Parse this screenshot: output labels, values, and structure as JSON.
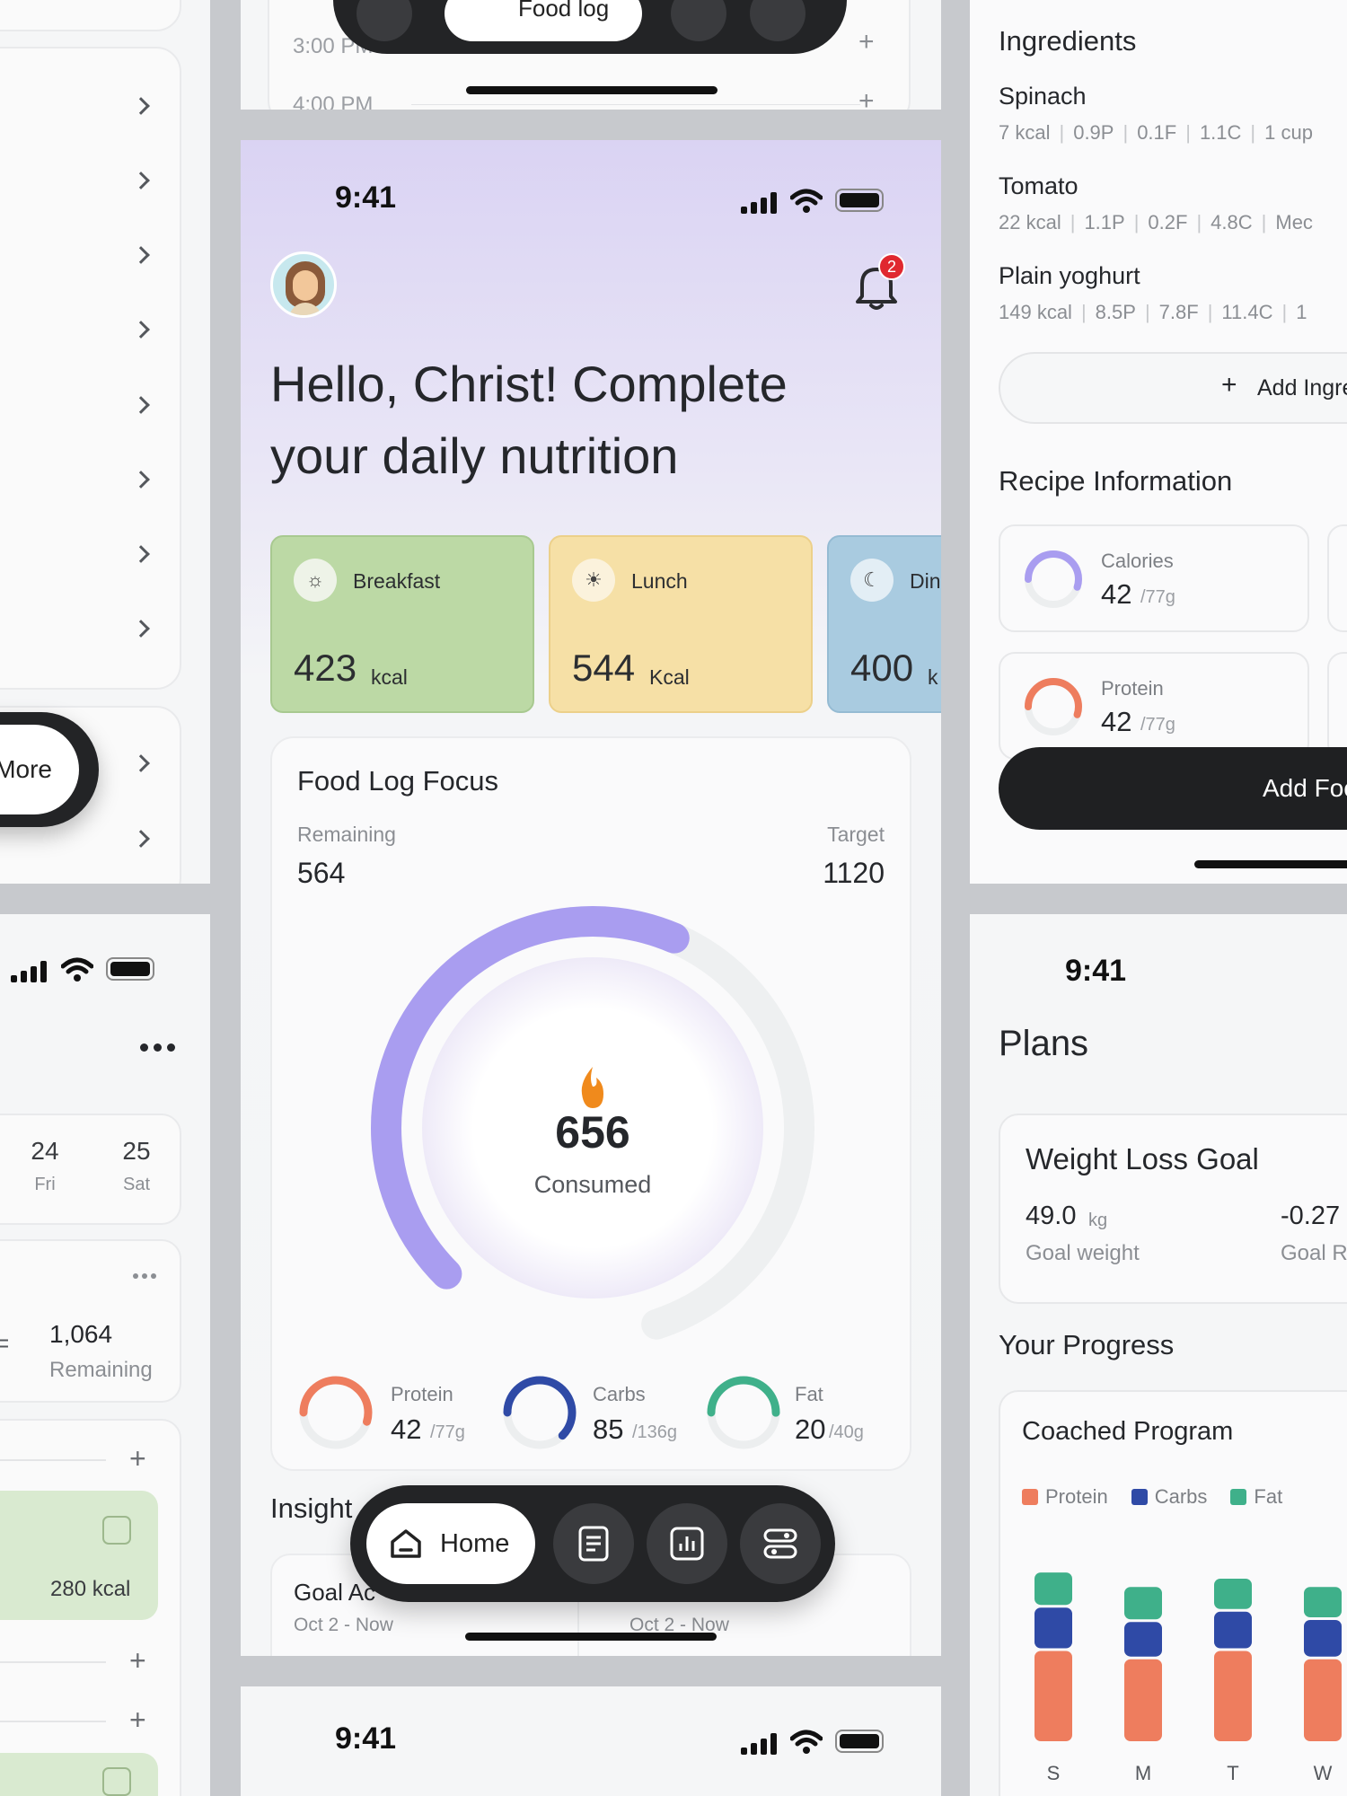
{
  "left_top": {
    "more_label": "More"
  },
  "top_mid": {
    "times": [
      "3:00 PM",
      "4:00 PM"
    ],
    "nav_active_label": "Food log"
  },
  "main": {
    "status_time": "9:41",
    "notification_count": "2",
    "greeting_line1": "Hello, Christ! Complete",
    "greeting_line2": "your daily nutrition",
    "meals": [
      {
        "label": "Breakfast",
        "value": "423",
        "unit": "kcal",
        "color": "#bcd9a5"
      },
      {
        "label": "Lunch",
        "value": "544",
        "unit": "Kcal",
        "color": "#f6e0a6"
      },
      {
        "label": "Din",
        "value": "400",
        "unit": "k",
        "color": "#a9cbe0"
      }
    ],
    "focus": {
      "title": "Food Log Focus",
      "remaining_label": "Remaining",
      "remaining_value": "564",
      "target_label": "Target",
      "target_value": "1120",
      "consumed_value": "656",
      "consumed_label": "Consumed",
      "progress_fraction": 0.586,
      "macros": [
        {
          "name": "Protein",
          "value": "42",
          "total": "/77g",
          "fraction": 0.545,
          "color": "#ee7d5e"
        },
        {
          "name": "Carbs",
          "value": "85",
          "total": "/136g",
          "fraction": 0.625,
          "color": "#2f4aa6"
        },
        {
          "name": "Fat",
          "value": "20",
          "total": "/40g",
          "fraction": 0.5,
          "color": "#3fb08a"
        }
      ]
    },
    "insights_title": "Insight",
    "insight_cards": [
      {
        "title": "Goal Ac",
        "date": "Oct 2 - Now"
      },
      {
        "title": "",
        "date": "Oct 2 - Now"
      }
    ],
    "nav_home_label": "Home"
  },
  "bottom_mid": {
    "status_time": "9:41"
  },
  "left_bottom": {
    "days": [
      {
        "num": "24",
        "name": "Fri"
      },
      {
        "num": "25",
        "name": "Sat"
      }
    ],
    "remaining_value": "1,064",
    "remaining_label": "Remaining",
    "equals": "=",
    "meal_kcal": "280 kcal"
  },
  "right_top": {
    "ingredients_title": "Ingredients",
    "ingredients": [
      {
        "name": "Spinach",
        "stats": [
          "7 kcal",
          "0.9P",
          "0.1F",
          "1.1C",
          "1 cup"
        ]
      },
      {
        "name": "Tomato",
        "stats": [
          "22 kcal",
          "1.1P",
          "0.2F",
          "4.8C",
          "Mec"
        ]
      },
      {
        "name": "Plain yoghurt",
        "stats": [
          "149 kcal",
          "8.5P",
          "7.8F",
          "11.4C",
          "1"
        ]
      }
    ],
    "add_ingredient_label": "Add Ingre",
    "recipe_title": "Recipe Information",
    "recipe_items": [
      {
        "name": "Calories",
        "value": "42",
        "total": "/77g",
        "fraction": 0.55,
        "color": "#a99df0"
      },
      {
        "name": "Protein",
        "value": "42",
        "total": "/77g",
        "fraction": 0.55,
        "color": "#ee7d5e"
      }
    ],
    "add_food_label": "Add Foo"
  },
  "right_bottom": {
    "status_time": "9:41",
    "title": "Plans",
    "goal_title": "Weight Loss Goal",
    "goal_weight_value": "49.0",
    "goal_weight_unit": "kg",
    "goal_weight_label": "Goal weight",
    "goal_rate_value": "-0.27",
    "goal_rate_label": "Goal R",
    "progress_title": "Your Progress",
    "program_title": "Coached Program",
    "chart_data": {
      "type": "bar",
      "stacked": true,
      "categories": [
        "S",
        "M",
        "T",
        "W"
      ],
      "series": [
        {
          "name": "Protein",
          "color": "#ee7d5e",
          "values": [
            45,
            41,
            45,
            41
          ]
        },
        {
          "name": "Carbs",
          "color": "#2f4aa6",
          "values": [
            21,
            18,
            19,
            19
          ]
        },
        {
          "name": "Fat",
          "color": "#3fb08a",
          "values": [
            17,
            17,
            16,
            16
          ]
        }
      ],
      "legend_position": "top-left"
    }
  }
}
